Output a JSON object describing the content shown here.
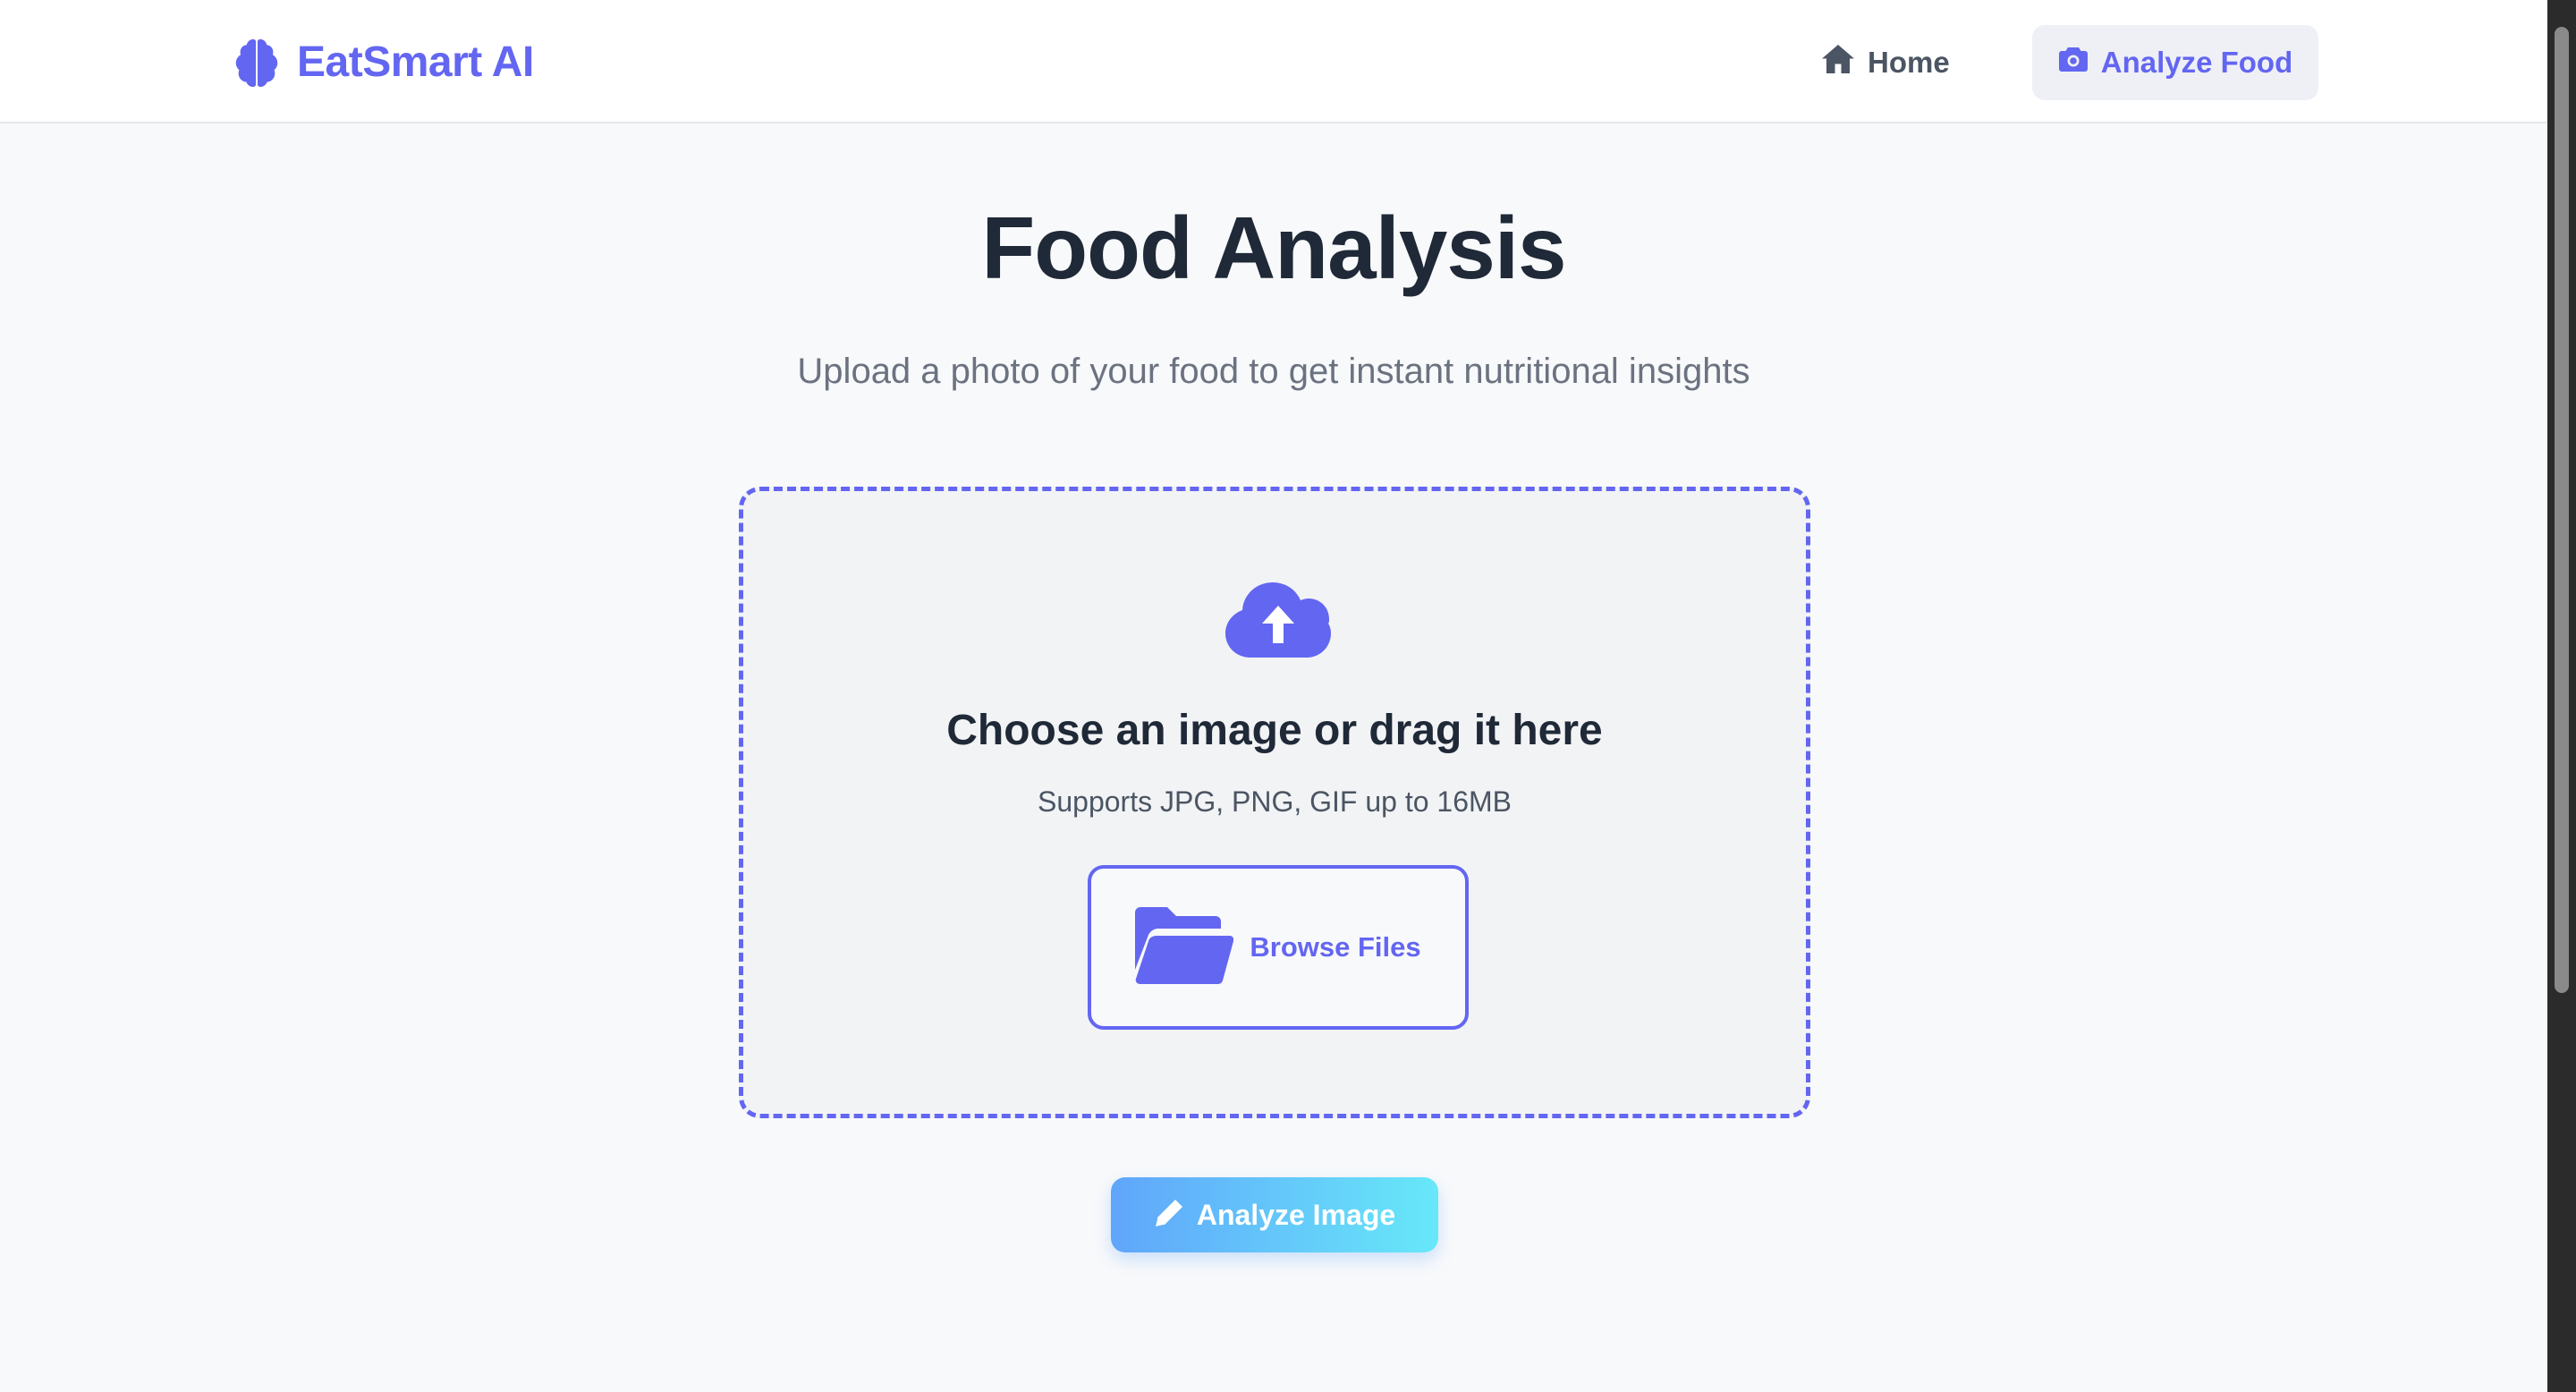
{
  "header": {
    "brand_name": "EatSmart AI",
    "brand_icon": "brain-icon",
    "nav": {
      "home_label": "Home",
      "home_icon": "home-icon",
      "analyze_label": "Analyze Food",
      "analyze_icon": "camera-icon",
      "active": "Analyze Food"
    }
  },
  "main": {
    "title": "Food Analysis",
    "subtitle": "Upload a photo of your food to get instant nutritional insights",
    "dropzone": {
      "icon": "cloud-upload-icon",
      "title": "Choose an image or drag it here",
      "hint": "Supports JPG, PNG, GIF up to 16MB",
      "browse_label": "Browse Files",
      "browse_icon": "folder-open-icon"
    },
    "analyze_button": {
      "label": "Analyze Image",
      "icon": "pencil-icon"
    }
  },
  "colors": {
    "accent": "#6366f1",
    "background": "#f8f9fb",
    "gradient_start": "#60a5fa",
    "gradient_end": "#67e8f9"
  }
}
